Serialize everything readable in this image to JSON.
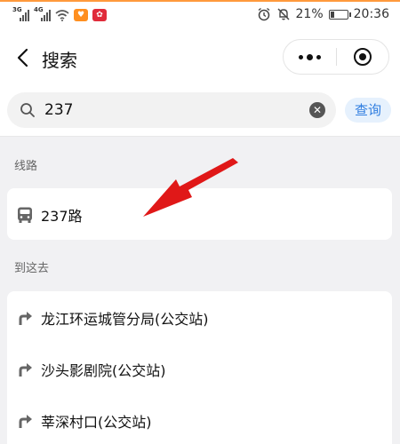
{
  "status_bar": {
    "sig1_gen": "3G",
    "sig2_gen": "4G",
    "notify_icons": [
      "orange-app-icon",
      "huawei-app-icon"
    ],
    "battery": "21%",
    "time": "20:36",
    "icons": [
      "alarm-icon",
      "mute-icon",
      "battery-icon"
    ]
  },
  "nav": {
    "title": "搜索",
    "icons": [
      "back-icon",
      "more-icon",
      "close-miniprogram-icon"
    ]
  },
  "search": {
    "value": "237",
    "query_label": "查询",
    "icons": [
      "search-icon",
      "clear-icon"
    ]
  },
  "sections": {
    "lines": {
      "title": "线路",
      "items": [
        {
          "label": "237路",
          "icon": "bus-icon"
        }
      ]
    },
    "goto": {
      "title": "到这去",
      "items": [
        {
          "label": "龙江环运城管分局(公交站)",
          "icon": "turn-arrow-icon"
        },
        {
          "label": "沙头影剧院(公交站)",
          "icon": "turn-arrow-icon"
        },
        {
          "label": "莘深村口(公交站)",
          "icon": "turn-arrow-icon"
        }
      ]
    }
  },
  "annotation": {
    "icon": "red-pointer-arrow",
    "color": "#e01818"
  },
  "colors": {
    "accent": "#2f7de0",
    "query_bg": "#e6f1fd",
    "page_bg": "#f1f1f3",
    "topline": "#ff9a3c"
  }
}
